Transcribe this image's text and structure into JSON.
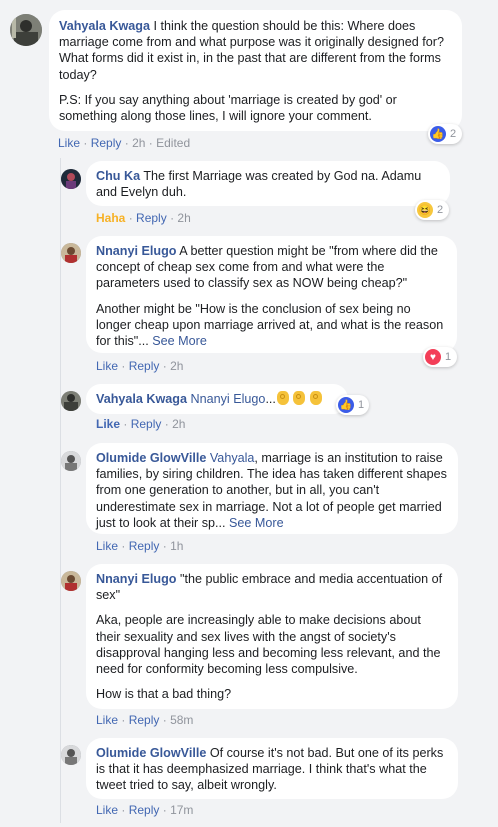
{
  "colors": {
    "author": "#385898",
    "link": "#4267b2",
    "meta": "#90949c",
    "haha": "#f7b125",
    "like": "#3b5ce8",
    "love": "#f33e58"
  },
  "c1": {
    "author": "Vahyala Kwaga",
    "p1": "I think the question should be this: Where does marriage come from and what purpose was it originally designed for? What forms did it exist in, in the past that are different from the forms today?",
    "p2": "P.S: If you say anything about 'marriage is created by god' or something along those lines, I will ignore your comment.",
    "like": "Like",
    "reply": "Reply",
    "time": "2h",
    "edited": "Edited",
    "reaction": {
      "icon": "like-icon",
      "count": "2"
    }
  },
  "c2": {
    "author": "Chu Ka",
    "text": "The first Marriage was created by God na. Adamu and Evelyn duh.",
    "reacted": "Haha",
    "reply": "Reply",
    "time": "2h",
    "reaction": {
      "icon": "haha-icon",
      "count": "2"
    }
  },
  "c3": {
    "author": "Nnanyi Elugo",
    "p1": "A better question might be \"from where did the concept of cheap sex come from and what were the parameters used to classify sex as NOW being cheap?\"",
    "p2": "Another might be \"How is the conclusion of sex being no longer cheap upon marriage arrived at, and what is the reason for this\"...",
    "see_more": "See More",
    "like": "Like",
    "reply": "Reply",
    "time": "2h",
    "reaction": {
      "icon": "love-icon",
      "count": "1"
    }
  },
  "c4": {
    "author": "Vahyala Kwaga",
    "mention": "Nnanyi Elugo",
    "text": "...",
    "like": "Like",
    "reply": "Reply",
    "time": "2h",
    "reaction": {
      "icon": "like-icon",
      "count": "1"
    }
  },
  "c5": {
    "author": "Olumide GlowVille",
    "mention": "Vahyala",
    "text": ", marriage is an institution to raise families, by siring children. The idea has taken different shapes from one generation to another, but in all, you can't underestimate sex in marriage. Not a lot of people get married just to look at their sp...",
    "see_more": "See More",
    "like": "Like",
    "reply": "Reply",
    "time": "1h"
  },
  "c6": {
    "author": "Nnanyi Elugo",
    "p1": "\"the public embrace and media accentuation of sex\"",
    "p2": "Aka, people are increasingly able to make decisions about their sexuality and sex lives with the angst of society's disapproval hanging less and becoming less relevant, and the need for conformity becoming less compulsive.",
    "p3": "How is that a bad thing?",
    "like": "Like",
    "reply": "Reply",
    "time": "58m"
  },
  "c7": {
    "author": "Olumide GlowVille",
    "text": "Of course it's not bad. But one of its perks is that it has deemphasized marriage. I think that's what the tweet tried to say, albeit wrongly.",
    "like": "Like",
    "reply": "Reply",
    "time": "17m"
  },
  "sep": "·"
}
